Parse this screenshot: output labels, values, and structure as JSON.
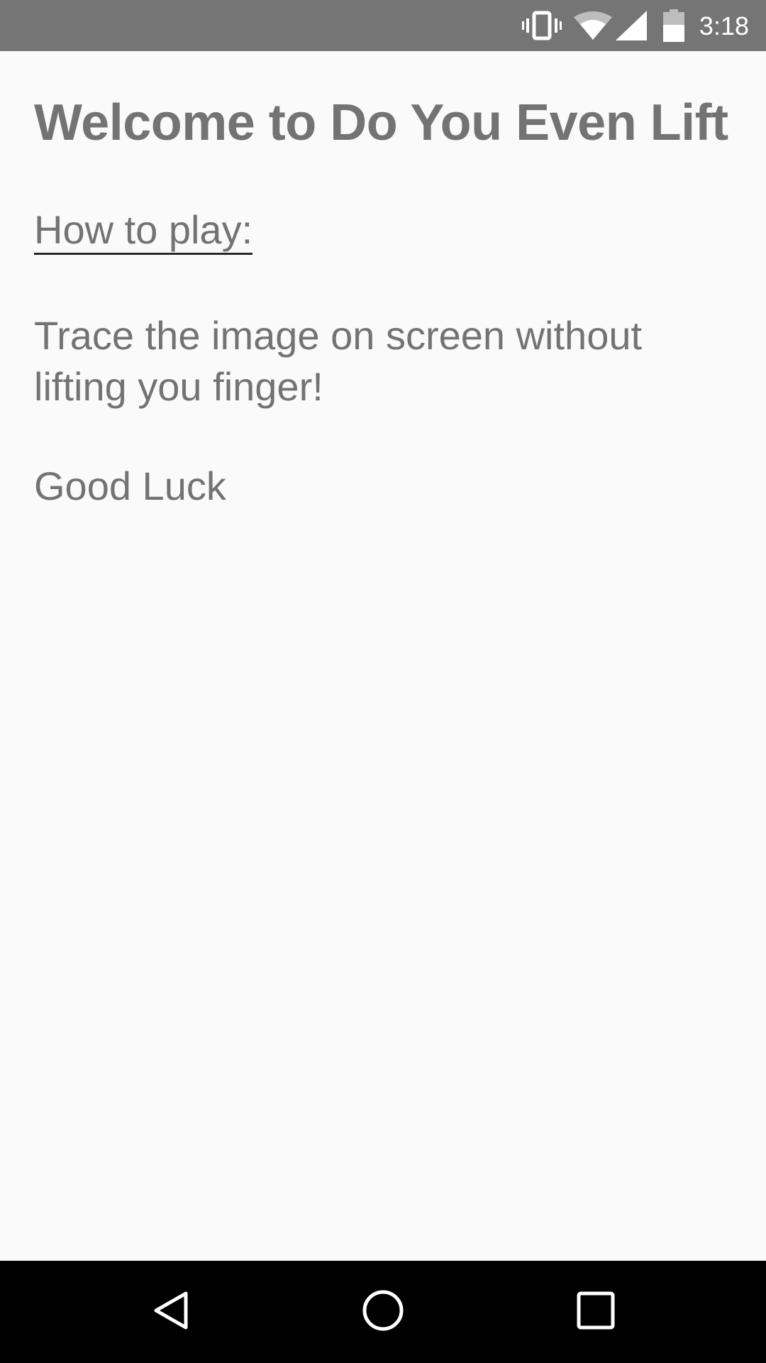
{
  "status_bar": {
    "time": "3:18",
    "icons": [
      "vibrate-icon",
      "wifi-icon",
      "cell-signal-icon",
      "battery-icon"
    ],
    "background": "#757575"
  },
  "main": {
    "title": "Welcome to Do You Even Lift",
    "how_to_label": "How to play:",
    "instructions": "Trace the image on screen without lifting you finger!",
    "good_luck": "Good Luck",
    "text_color": "#737373"
  },
  "nav_bar": {
    "buttons": [
      "back-icon",
      "home-icon",
      "recents-icon"
    ],
    "background": "#000000"
  }
}
